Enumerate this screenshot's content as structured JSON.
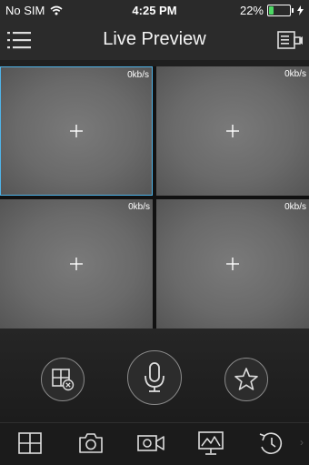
{
  "status_bar": {
    "carrier": "No SIM",
    "time": "4:25 PM",
    "battery_percent": "22%",
    "battery_level": 0.22
  },
  "nav": {
    "title": "Live Preview",
    "menu_icon": "list-menu-icon",
    "right_icon": "playback-list-icon"
  },
  "grid": {
    "cells": [
      {
        "rate": "0kb/s",
        "selected": true
      },
      {
        "rate": "0kb/s",
        "selected": false
      },
      {
        "rate": "0kb/s",
        "selected": false
      },
      {
        "rate": "0kb/s",
        "selected": false
      }
    ],
    "accent_color": "#4fb3e8"
  },
  "controls": {
    "left_icon": "close-all-channels-icon",
    "center_icon": "microphone-icon",
    "right_icon": "star-favorite-icon"
  },
  "toolbar": {
    "items": [
      "window-split-icon",
      "camera-snapshot-icon",
      "video-record-icon",
      "picture-quality-icon",
      "playback-history-icon"
    ],
    "more": "›"
  }
}
